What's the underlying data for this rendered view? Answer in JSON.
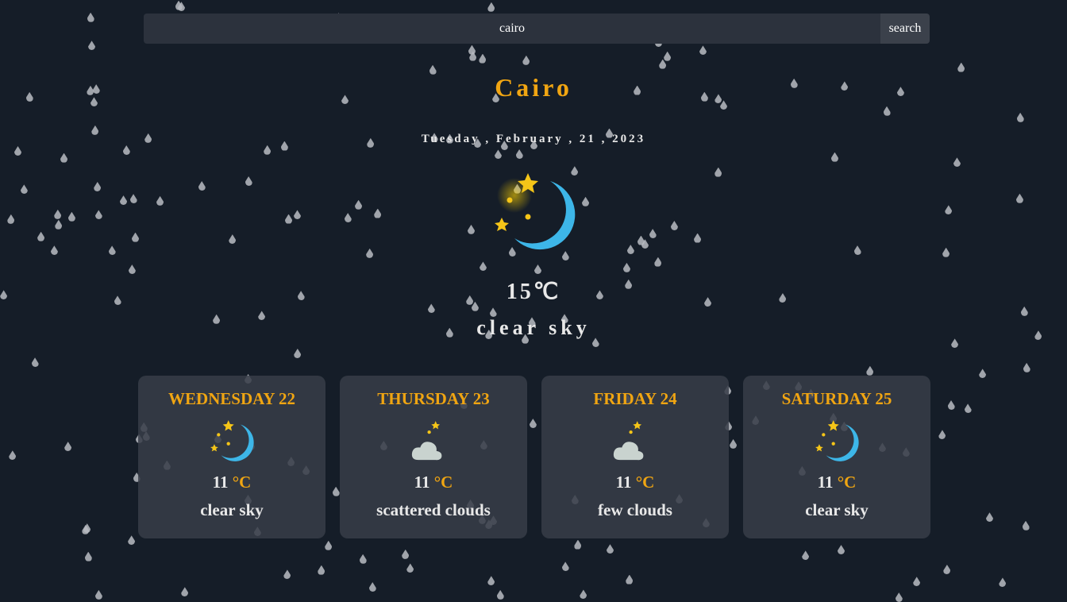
{
  "search": {
    "value": "cairo",
    "button_label": "search"
  },
  "current": {
    "city": "Cairo",
    "date": "Tuesday , February , 21 , 2023",
    "temp": "15℃",
    "description": "clear sky",
    "icon": "clear-night-icon"
  },
  "forecast": [
    {
      "day": "WEDNESDAY 22",
      "temp": "11",
      "unit": "°C",
      "description": "clear sky",
      "icon": "clear-night-icon"
    },
    {
      "day": "THURSDAY 23",
      "temp": "11",
      "unit": "°C",
      "description": "scattered clouds",
      "icon": "cloudy-night-icon"
    },
    {
      "day": "FRIDAY 24",
      "temp": "11",
      "unit": "°C",
      "description": "few clouds",
      "icon": "cloudy-night-icon"
    },
    {
      "day": "SATURDAY 25",
      "temp": "11",
      "unit": "°C",
      "description": "clear sky",
      "icon": "clear-night-icon"
    }
  ],
  "colors": {
    "accent": "#f0a512",
    "background": "#151d28",
    "card": "#373d48"
  }
}
